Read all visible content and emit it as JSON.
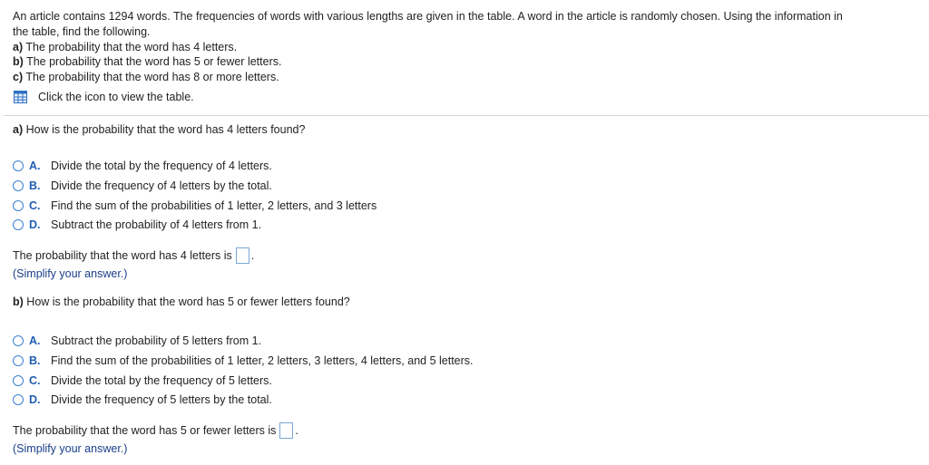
{
  "intro": {
    "line1": "An article contains 1294 words. The frequencies of words with various lengths are given in the table. A word in the article is randomly chosen. Using the information in",
    "line2": "the table, find the following.",
    "parts": [
      {
        "label": "a)",
        "text": "The probability that the word has 4 letters."
      },
      {
        "label": "b)",
        "text": "The probability that the word has 5 or fewer letters."
      },
      {
        "label": "c)",
        "text": "The probability that the word has 8 or more letters."
      }
    ],
    "table_link": "Click the icon to view the table."
  },
  "part_a": {
    "label": "a)",
    "question": "How is the probability that the word has 4 letters found?",
    "options": [
      {
        "letter": "A.",
        "text": "Divide the total by the frequency of 4 letters."
      },
      {
        "letter": "B.",
        "text": "Divide the frequency of 4 letters by the total."
      },
      {
        "letter": "C.",
        "text": "Find the sum of the probabilities of 1 letter, 2 letters, and 3 letters"
      },
      {
        "letter": "D.",
        "text": "Subtract the probability of 4 letters from 1."
      }
    ],
    "answer_prompt": "The probability that the word has 4 letters is",
    "answer_value": "",
    "hint": "(Simplify your answer.)"
  },
  "part_b": {
    "label": "b)",
    "question": "How is the probability that the word has 5 or fewer letters found?",
    "options": [
      {
        "letter": "A.",
        "text": "Subtract the probability of 5 letters from 1."
      },
      {
        "letter": "B.",
        "text": "Find the sum of the probabilities of 1 letter, 2 letters, 3 letters, 4 letters, and 5 letters."
      },
      {
        "letter": "C.",
        "text": "Divide the total by the frequency of 5 letters."
      },
      {
        "letter": "D.",
        "text": "Divide the frequency of 5 letters by the total."
      }
    ],
    "answer_prompt": "The probability that the word has 5 or fewer letters is",
    "answer_value": "",
    "hint": "(Simplify your answer.)"
  },
  "colors": {
    "accent": "#3b7fd4",
    "letter": "#1f5db3",
    "hint": "#1a3f8a",
    "divider": "#d4d4d4"
  },
  "icons": {
    "table": "table-grid-icon",
    "radio": "radio-button"
  }
}
